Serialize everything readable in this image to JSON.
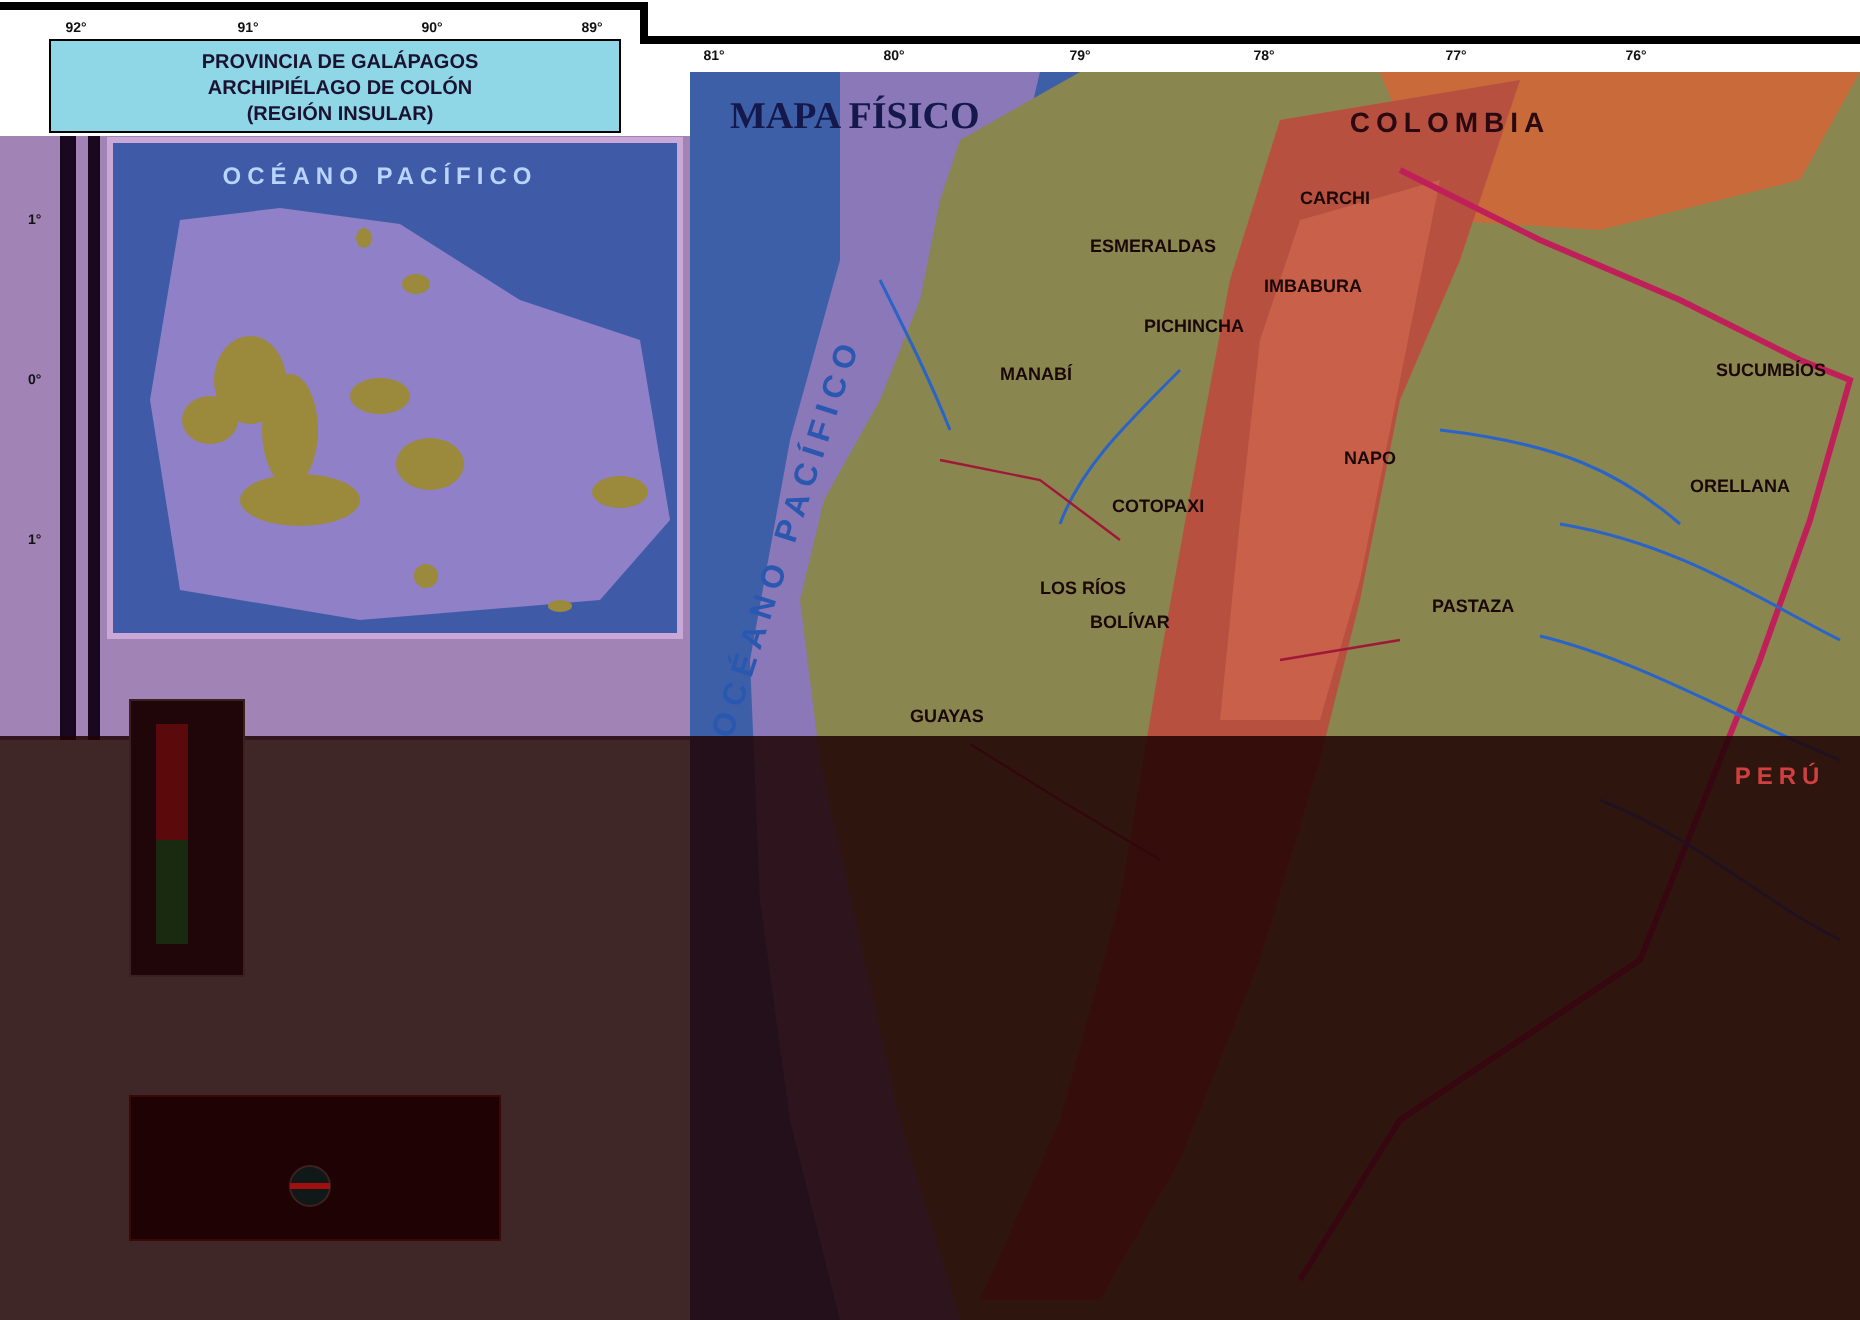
{
  "inset": {
    "title_lines": [
      "PROVINCIA DE GALÁPAGOS",
      "ARCHIPIÉLAGO DE COLÓN",
      "(REGIÓN INSULAR)"
    ],
    "ocean_label": "OCÉANO PACÍFICO",
    "longitude_ticks": [
      "92°",
      "91°",
      "90°",
      "89°"
    ],
    "latitude_ticks": [
      "1°",
      "0°",
      "1°"
    ]
  },
  "main": {
    "title": "MAPA FÍSICO",
    "longitude_ticks": [
      "81°",
      "80°",
      "79°",
      "78°",
      "77°",
      "76°"
    ],
    "labels": [
      {
        "text": "COLOMBIA",
        "kind": "country"
      },
      {
        "text": "CARCHI",
        "kind": "province"
      },
      {
        "text": "ESMERALDAS",
        "kind": "province"
      },
      {
        "text": "IMBABURA",
        "kind": "province"
      },
      {
        "text": "PICHINCHA",
        "kind": "province"
      },
      {
        "text": "MANABÍ",
        "kind": "province"
      },
      {
        "text": "SUCUMBÍOS",
        "kind": "province"
      },
      {
        "text": "NAPO",
        "kind": "province"
      },
      {
        "text": "ORELLANA",
        "kind": "province"
      },
      {
        "text": "COTOPAXI",
        "kind": "province"
      },
      {
        "text": "LOS RÍOS",
        "kind": "province"
      },
      {
        "text": "BOLÍVAR",
        "kind": "province"
      },
      {
        "text": "PASTAZA",
        "kind": "province"
      },
      {
        "text": "GUAYAS",
        "kind": "province"
      },
      {
        "text": "OCÉANO PACÍFICO",
        "kind": "ocean"
      },
      {
        "text": "PERÚ",
        "kind": "shaded_country"
      }
    ]
  }
}
